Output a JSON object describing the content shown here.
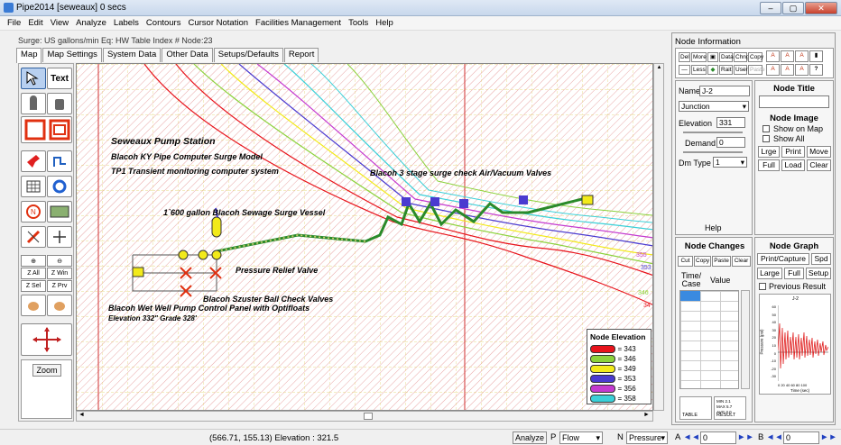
{
  "window": {
    "title": "Pipe2014 [seweaux] 0 secs",
    "min": "–",
    "max": "▢",
    "close": "✕"
  },
  "menu": [
    "File",
    "Edit",
    "View",
    "Analyze",
    "Labels",
    "Contours",
    "Cursor Notation",
    "Facilities Management",
    "Tools",
    "Help"
  ],
  "status_line": "Surge: US gallons/min  Eq: HW  Table Index # Node:23",
  "tabs": [
    "Map",
    "Map Settings",
    "System Data",
    "Other Data",
    "Setups/Defaults",
    "Report"
  ],
  "tools": {
    "text": "Text",
    "zall": "Z All",
    "zwin": "Z Win",
    "zsel": "Z Sel",
    "zprv": "Z Prv",
    "zoom": "Zoom"
  },
  "map": {
    "title": "Seweaux Pump Station",
    "line2": "Blacoh KY Pipe Computer Surge Model",
    "line3": "TP1 Transient monitoring computer system",
    "valves": "Blacoh 3 stage surge check Air/Vacuum Valves",
    "vessel": "1`600 gallon Blacoh Sewage Surge Vessel",
    "prv": "Pressure Relief Valve",
    "ballcheck": "Blacoh Szuster Ball Check Valves",
    "panel": "Blacoh Wet Well Pump Control Panel with Optifloats",
    "elev": "Elevation 332\" Grade 328'",
    "contour_labels": [
      "355",
      "353",
      "346",
      "34"
    ]
  },
  "legend": {
    "title": "Node Elevation",
    "items": [
      {
        "label": "= 343",
        "color": "#e8141c"
      },
      {
        "label": "= 346",
        "color": "#8cd23c"
      },
      {
        "label": "= 349",
        "color": "#f2ea1a"
      },
      {
        "label": "= 353",
        "color": "#4a3ad0"
      },
      {
        "label": "= 356",
        "color": "#c43ad0"
      },
      {
        "label": "= 358",
        "color": "#3ad0d8"
      }
    ]
  },
  "coord": "(566.71, 155.13)  Elevation : 321.5",
  "bottom": {
    "analyze": "Analyze",
    "p": "P",
    "p_val": "Flow",
    "n": "N",
    "n_val": "Pressure",
    "a": "A",
    "a_val": "0",
    "b": "B",
    "b_val": "0"
  },
  "node_info": {
    "title": "Node Information",
    "btns_row1": [
      "Del",
      "More",
      "Data",
      "Chng",
      "Copy"
    ],
    "btns_row2": [
      "Less",
      "Rait",
      "User",
      "Paste"
    ],
    "name_label": "Name",
    "name_val": "J-2",
    "type_val": "Junction",
    "elev_label": "Elevation",
    "elev_val": "331",
    "demand_label": "Demand",
    "demand_val": "0",
    "dmtype_label": "Dm Type",
    "dmtype_val": "1",
    "help": "Help",
    "node_title_hdr": "Node Title",
    "node_image_hdr": "Node Image",
    "show_on_map": "Show on Map",
    "show_all": "Show All",
    "img_btns": [
      "Lrge",
      "Print",
      "Move",
      "Full",
      "Load",
      "Clear"
    ],
    "changes_hdr": "Node Changes",
    "changes_btns": [
      "Cut",
      "Copy",
      "Paste",
      "Clear"
    ],
    "col_time": "Time/ Case",
    "col_value": "Value",
    "table_lbl": "TABLE",
    "result_lbl": "RESULT",
    "graph_hdr": "Node Graph",
    "print_capture": "Print/Capture",
    "spd": "Spd",
    "large": "Large",
    "full": "Full",
    "setup": "Setup",
    "prev_result": "Previous Result",
    "graph_title": "J-2",
    "graph_ylabel": "Pressure (psi)",
    "graph_xlabel": "Time (sec)",
    "graph_yticks": [
      "60",
      "50",
      "40",
      "30",
      "20",
      "10",
      "0",
      "-10",
      "-20",
      "-30"
    ],
    "graph_xticks": "0 20 40 60 80 100",
    "stats": [
      "MIN 2.1",
      "MAX 5.7",
      "AVG 3.0"
    ]
  }
}
